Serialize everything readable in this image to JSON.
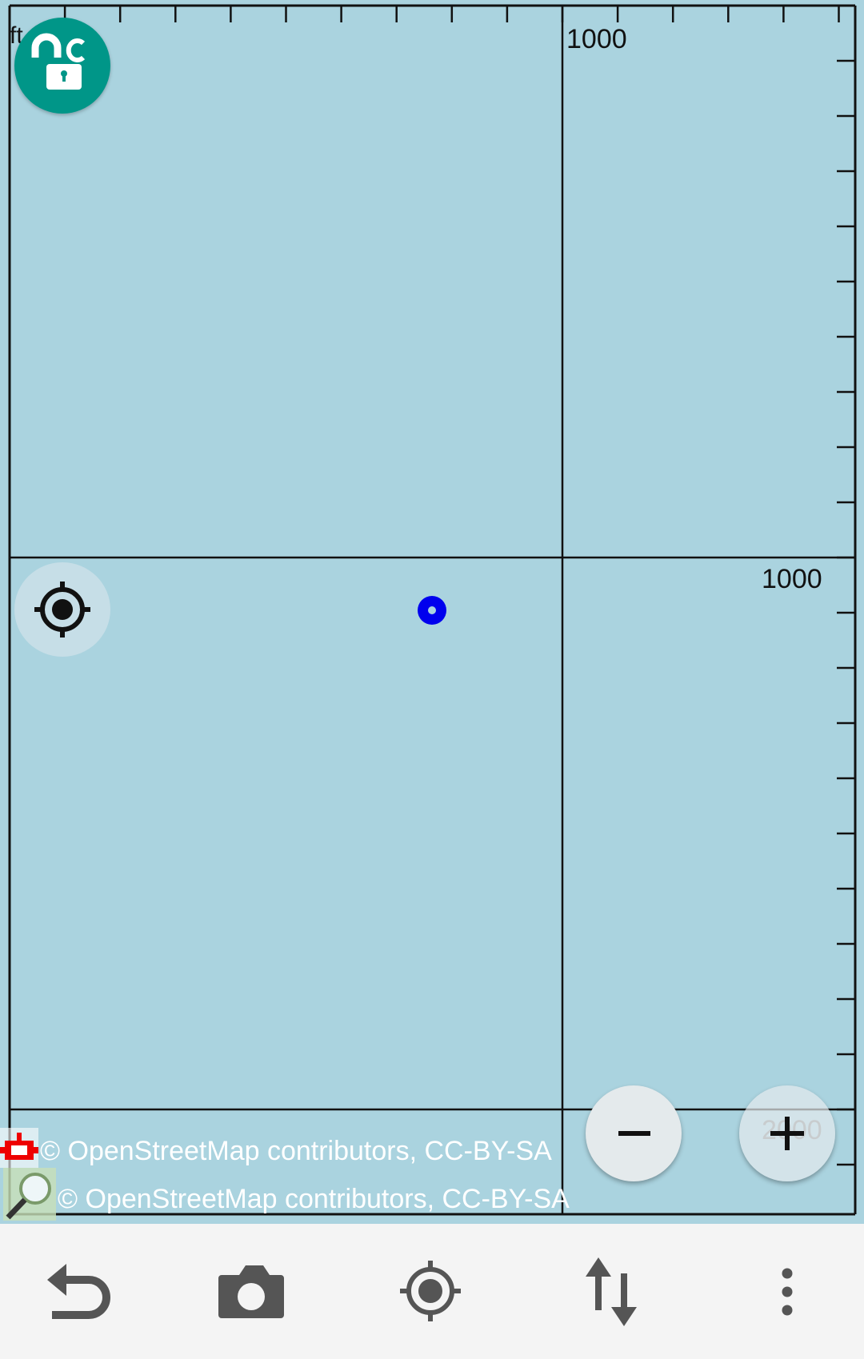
{
  "map": {
    "unit_label": "ft",
    "top_scale_label": "1000",
    "right_scale_labels": [
      "1000",
      "2000"
    ],
    "background_color": "#aad3df",
    "attribution_lines": [
      "© OpenStreetMap contributors, CC-BY-SA",
      "© OpenStreetMap contributors, CC-BY-SA"
    ]
  },
  "controls": {
    "lock_icon": "lock-open-icon",
    "locate_icon": "gps-fixed-icon",
    "zoom_out_icon": "minus-icon",
    "zoom_in_icon": "plus-icon",
    "accent_color": "#009688",
    "position_color": "#0000ee"
  },
  "bottom_bar": {
    "items": [
      {
        "icon": "undo-icon"
      },
      {
        "icon": "camera-icon"
      },
      {
        "icon": "gps-icon"
      },
      {
        "icon": "transfer-icon"
      },
      {
        "icon": "overflow-menu-icon"
      }
    ]
  }
}
